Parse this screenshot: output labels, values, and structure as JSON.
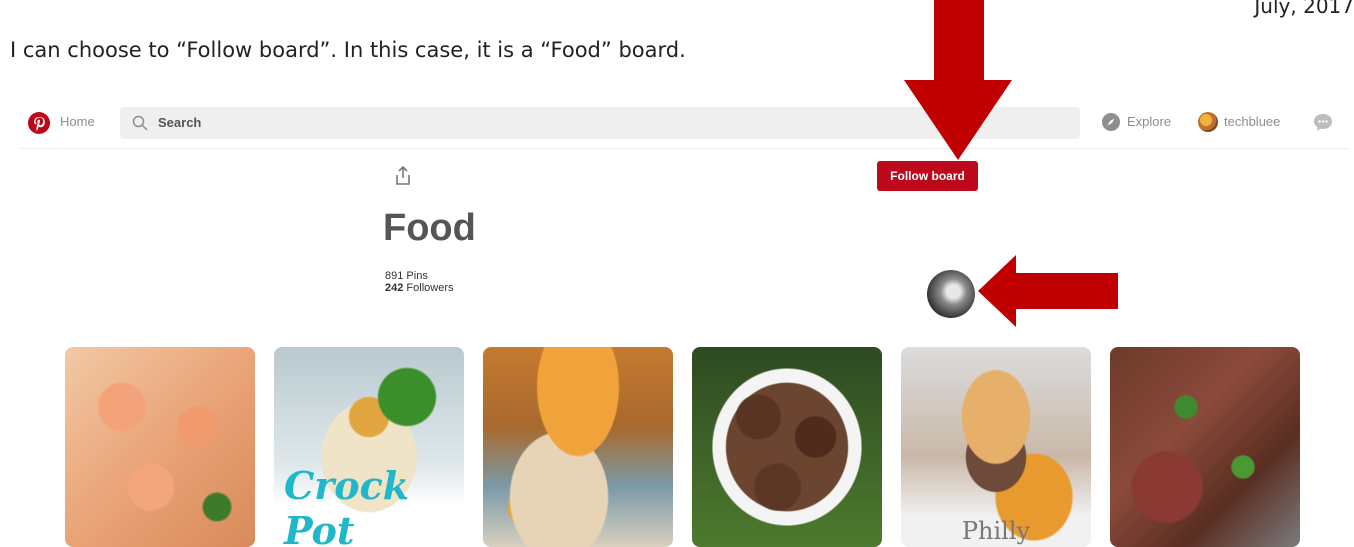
{
  "document": {
    "date": "July, 2017",
    "caption": "I can choose to “Follow board”. In this case, it is a “Food” board."
  },
  "topbar": {
    "home_label": "Home",
    "search_placeholder": "Search",
    "explore_label": "Explore",
    "username": "techbluee",
    "icons": [
      "pinterest-logo-icon",
      "search-icon",
      "compass-icon",
      "chat-icon"
    ]
  },
  "board": {
    "title": "Food",
    "pins_count": "891",
    "pins_label": "Pins",
    "followers_count": "242",
    "followers_label": "Followers",
    "follow_button": "Follow board"
  },
  "pins": [
    {
      "name": "shrimp"
    },
    {
      "name": "crock-pot-chicken",
      "overlay": "Crock Pot"
    },
    {
      "name": "casserole"
    },
    {
      "name": "steak-bites"
    },
    {
      "name": "slider",
      "overlay": "Philly"
    },
    {
      "name": "sliced-steak"
    }
  ],
  "colors": {
    "brand_red": "#bd081c",
    "arrow_red": "#c00000",
    "search_bg": "#efefef"
  }
}
